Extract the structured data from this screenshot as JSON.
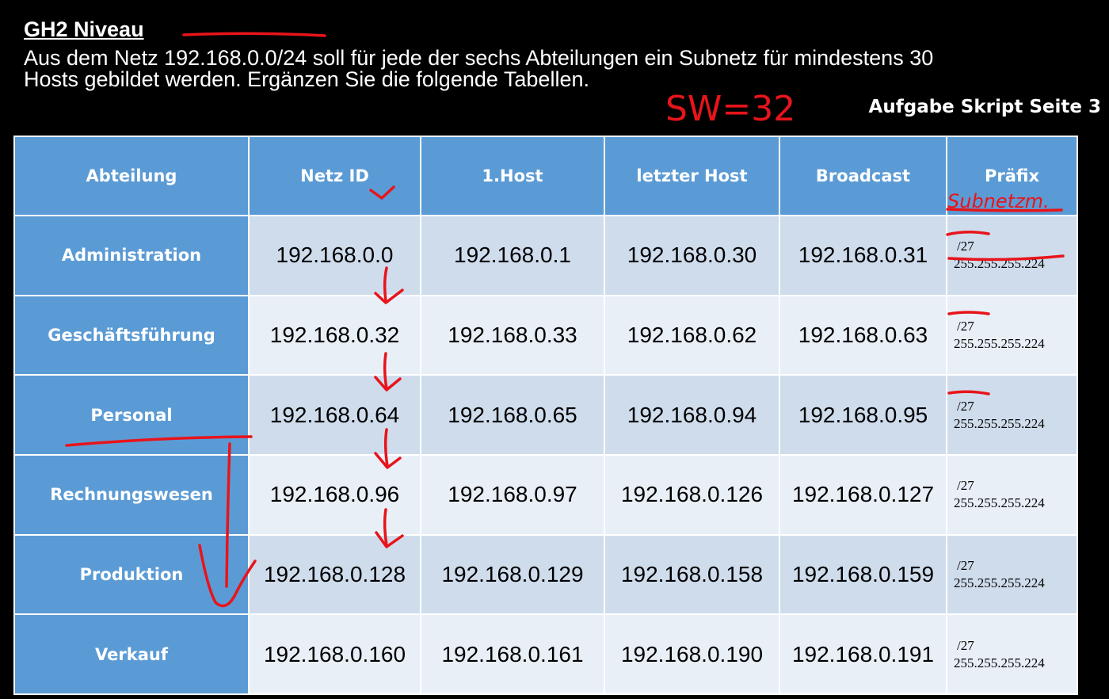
{
  "header": {
    "title": "GH2 Niveau",
    "task_line1": "Aus dem Netz 192.168.0.0/24 soll für jede der sechs Abteilungen ein Subnetz für mindestens 30",
    "task_line2": "Hosts gebildet werden. Ergänzen Sie die folgende Tabellen.",
    "reference": "Aufgabe Skript Seite 3"
  },
  "table": {
    "columns": [
      "Abteilung",
      "Netz ID",
      "1.Host",
      "letzter Host",
      "Broadcast",
      "Präfix"
    ],
    "rows": [
      {
        "abteilung": "Administration",
        "netz_id": "192.168.0.0",
        "first_host": "192.168.0.1",
        "last_host": "192.168.0.30",
        "broadcast": "192.168.0.31",
        "prefix": "/27",
        "mask": "255.255.255.224"
      },
      {
        "abteilung": "Geschäftsführung",
        "netz_id": "192.168.0.32",
        "first_host": "192.168.0.33",
        "last_host": "192.168.0.62",
        "broadcast": "192.168.0.63",
        "prefix": "/27",
        "mask": "255.255.255.224"
      },
      {
        "abteilung": "Personal",
        "netz_id": "192.168.0.64",
        "first_host": "192.168.0.65",
        "last_host": "192.168.0.94",
        "broadcast": "192.168.0.95",
        "prefix": "/27",
        "mask": "255.255.255.224"
      },
      {
        "abteilung": "Rechnungswesen",
        "netz_id": "192.168.0.96",
        "first_host": "192.168.0.97",
        "last_host": "192.168.0.126",
        "broadcast": "192.168.0.127",
        "prefix": "/27",
        "mask": "255.255.255.224"
      },
      {
        "abteilung": "Produktion",
        "netz_id": "192.168.0.128",
        "first_host": "192.168.0.129",
        "last_host": "192.168.0.158",
        "broadcast": "192.168.0.159",
        "prefix": "/27",
        "mask": "255.255.255.224"
      },
      {
        "abteilung": "Verkauf",
        "netz_id": "192.168.0.160",
        "first_host": "192.168.0.161",
        "last_host": "192.168.0.190",
        "broadcast": "192.168.0.191",
        "prefix": "/27",
        "mask": "255.255.255.224"
      }
    ]
  },
  "handwriting": {
    "block_size_note": "SW=32",
    "prefix_note": "Subnetzm."
  },
  "colors": {
    "header_blue": "#5b9bd5",
    "row_dark": "#cfdcec",
    "row_light": "#e9eff7",
    "ink_red": "#e8141b"
  }
}
